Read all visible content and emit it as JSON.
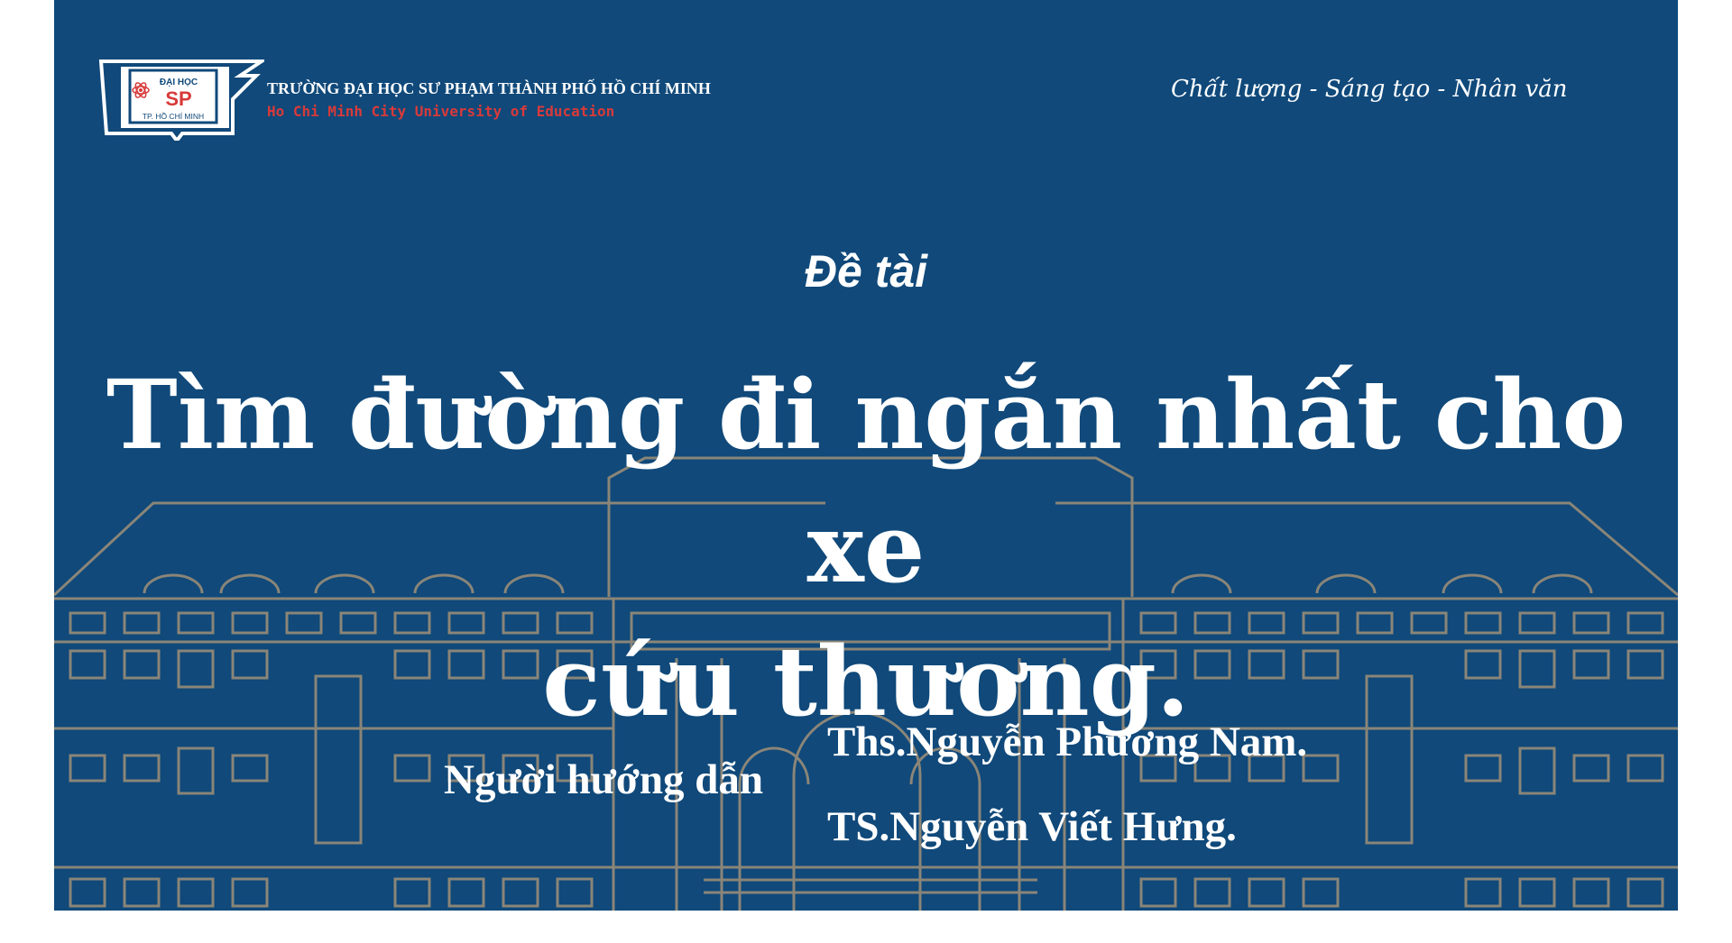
{
  "header": {
    "logo": {
      "top_text": "ĐẠI HỌC",
      "main_text": "SP",
      "bottom_text": "TP. HỒ CHÍ MINH",
      "icon": "atom-icon"
    },
    "university_name_vn": "TRƯỜNG ĐẠI HỌC SƯ PHẠM THÀNH PHỐ HỒ CHÍ MINH",
    "university_name_en": "Ho Chi Minh City University of Education",
    "motto": "Chất lượng - Sáng tạo - Nhân văn"
  },
  "main": {
    "topic_label": "Đề tài",
    "title_line1": "Tìm đường đi ngắn nhất cho xe",
    "title_line2": "cứu thương.",
    "advisor_label": "Người hướng dẫn",
    "advisors": [
      "Ths.Nguyễn Phương Nam.",
      "TS.Nguyễn Viết Hưng."
    ]
  },
  "colors": {
    "background": "#10497a",
    "line_art": "#8a8a7a",
    "text": "#ffffff",
    "accent_red": "#d83a3a"
  }
}
